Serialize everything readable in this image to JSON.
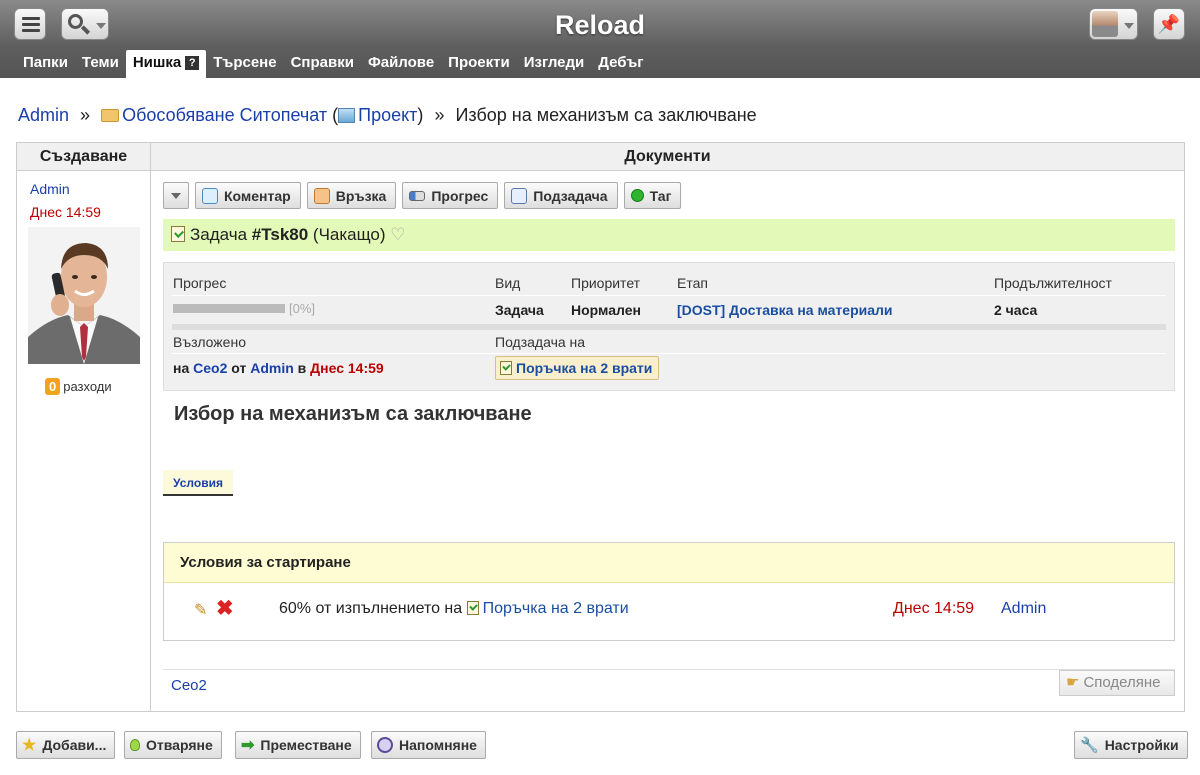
{
  "app": {
    "title": "Reload"
  },
  "tabs": [
    "Папки",
    "Теми",
    "Нишка",
    "Търсене",
    "Справки",
    "Файлове",
    "Проекти",
    "Изгледи",
    "Дебъг"
  ],
  "active_tab_help": "?",
  "breadcrumb": {
    "user": "Admin",
    "sep1": "»",
    "folder": "Обособяване Ситопечат",
    "paren_open": "(",
    "project": "Проект",
    "paren_close": ")",
    "sep2": "»",
    "current": "Избор на механизъм са заключване"
  },
  "columns": {
    "left": "Създаване",
    "right": "Документи"
  },
  "author": {
    "name": "Admin",
    "created": "Днес 14:59",
    "expenses_count": "0",
    "expenses_label": "разходи"
  },
  "toolbar": {
    "comment": "Коментар",
    "link": "Връзка",
    "progress": "Прогрес",
    "subtask": "Подзадача",
    "tag": "Таг"
  },
  "task": {
    "type_label": "Задача",
    "id": "#Tsk80",
    "status": "(Чакащо)"
  },
  "info": {
    "progress_label": "Прогрес",
    "progress_value": 0,
    "progress_text": "[0%]",
    "kind_label": "Вид",
    "kind": "Задача",
    "priority_label": "Приоритет",
    "priority": "Нормален",
    "stage_label": "Етап",
    "stage": "[DOST] Доставка на материали",
    "duration_label": "Продължителност",
    "duration": "2 часа",
    "assigned_label": "Възложено",
    "assigned_on": "на",
    "assigned_to": "Ceo2",
    "assigned_from": "от",
    "assigned_by": "Admin",
    "assigned_at": "в",
    "assigned_time": "Днес 14:59",
    "subtask_of_label": "Подзадача на",
    "subtask_of": "Поръчка на 2 врати"
  },
  "doc": {
    "title": "Избор на механизъм са заключване"
  },
  "conditions": {
    "tab": "Условия",
    "heading": "Условия за стартиране",
    "text_prefix": "60% от изпълнението на",
    "target": "Поръчка на 2 врати",
    "date": "Днес 14:59",
    "user": "Admin"
  },
  "footer": {
    "user": "Ceo2",
    "share": "Споделяне"
  },
  "bottom": {
    "add": "Добави...",
    "open": "Отваряне",
    "move": "Преместване",
    "remind": "Напомняне",
    "settings": "Настройки"
  },
  "colors": {
    "accent_link": "#1a3fa8",
    "date_red": "#bb0000",
    "banner_green": "#e2f9b7",
    "cond_yellow": "#fdfcd3"
  }
}
